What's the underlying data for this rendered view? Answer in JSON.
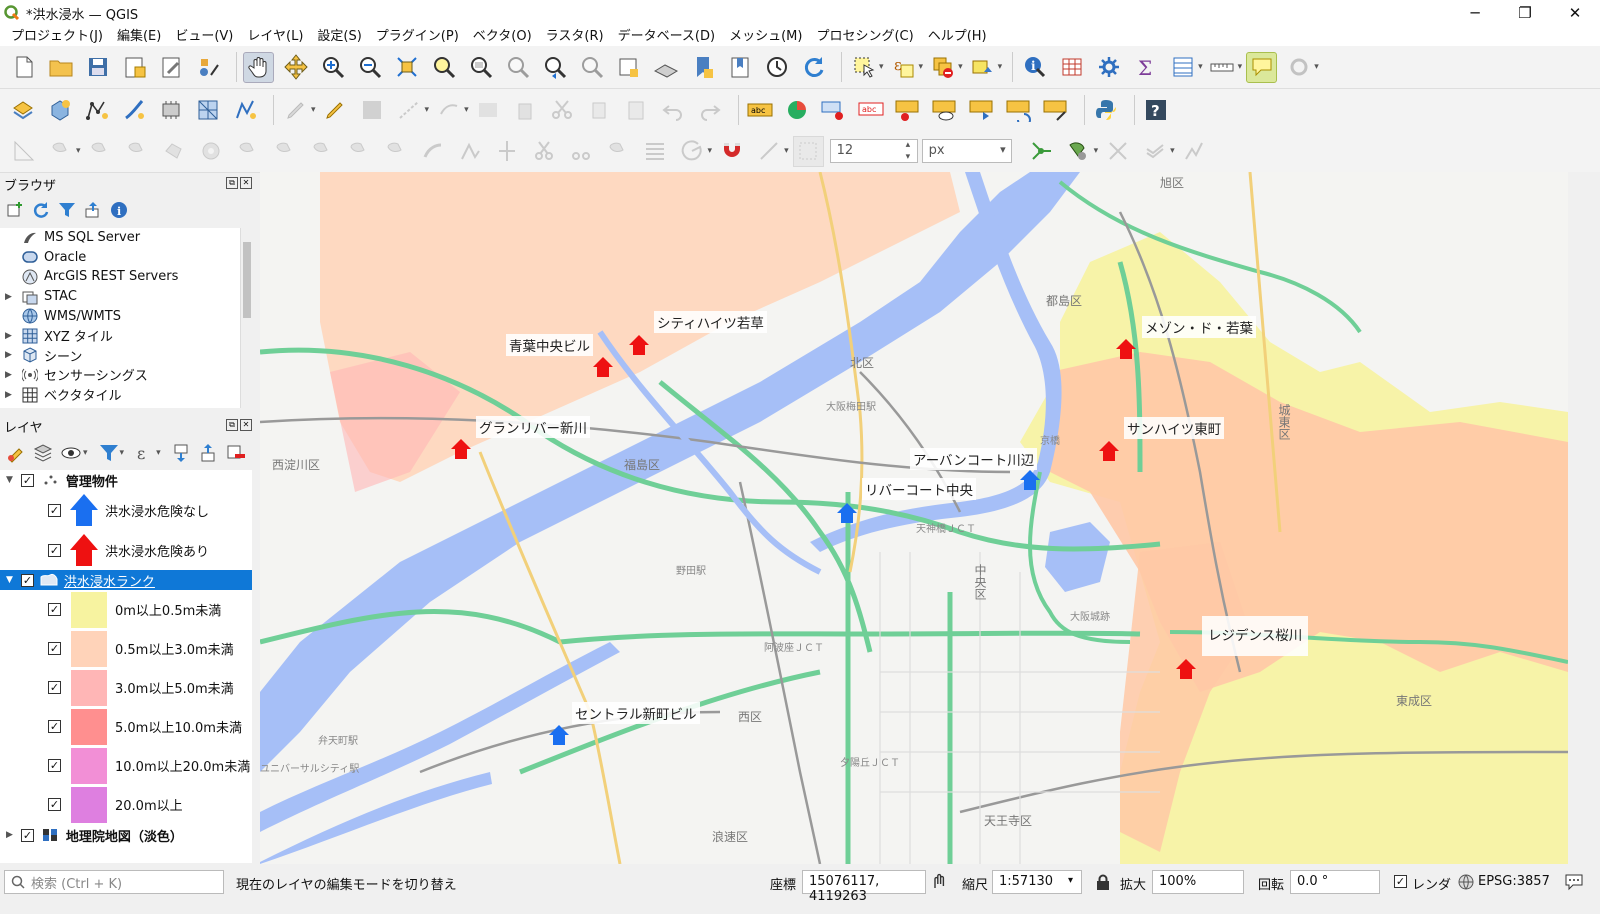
{
  "window": {
    "title": "*洪水浸水 — QGIS",
    "controls": [
      "─",
      "❐",
      "✕"
    ]
  },
  "menu": [
    "プロジェクト(J)",
    "編集(E)",
    "ビュー(V)",
    "レイヤ(L)",
    "設定(S)",
    "プラグイン(P)",
    "ベクタ(O)",
    "ラスタ(R)",
    "データベース(D)",
    "メッシュ(M)",
    "プロセシング(C)",
    "ヘルプ(H)"
  ],
  "digitizing": {
    "tolerance_value": "12",
    "tolerance_unit": "px"
  },
  "browser_panel": {
    "title": "ブラウザ",
    "items": [
      {
        "label": "MS SQL Server",
        "icon": "mssql-icon",
        "expandable": false
      },
      {
        "label": "Oracle",
        "icon": "oracle-icon",
        "expandable": false
      },
      {
        "label": "ArcGIS REST Servers",
        "icon": "arcgis-icon",
        "expandable": false
      },
      {
        "label": "STAC",
        "icon": "stac-icon",
        "expandable": true
      },
      {
        "label": "WMS/WMTS",
        "icon": "globe-icon",
        "expandable": false
      },
      {
        "label": "XYZ タイル",
        "icon": "grid-icon",
        "expandable": true
      },
      {
        "label": "シーン",
        "icon": "cube-icon",
        "expandable": true
      },
      {
        "label": "センサーシングス",
        "icon": "sensor-icon",
        "expandable": true
      },
      {
        "label": "ベクタタイル",
        "icon": "vectortile-icon",
        "expandable": true
      }
    ]
  },
  "layers_panel": {
    "title": "レイヤ",
    "groups": {
      "properties": {
        "label": "管理物件",
        "checked": true
      },
      "safe": {
        "label": "洪水浸水危険なし",
        "checked": true,
        "color": "#1a6ff0"
      },
      "danger": {
        "label": "洪水浸水危険あり",
        "checked": true,
        "color": "#ee1111"
      },
      "flood_rank": {
        "label": "洪水浸水ランク",
        "checked": true
      },
      "basemap": {
        "label": "地理院地図（淡色）",
        "checked": true
      }
    },
    "legend": [
      {
        "label": "0m以上0.5m未満",
        "color": "#f7f3a0"
      },
      {
        "label": "0.5m以上3.0m未満",
        "color": "#ffd3b9"
      },
      {
        "label": "3.0m以上5.0m未満",
        "color": "#ffb6b6"
      },
      {
        "label": "5.0m以上10.0m未満",
        "color": "#ff8f8f"
      },
      {
        "label": "10.0m以上20.0m未満",
        "color": "#f28fd6"
      },
      {
        "label": "20.0m以上",
        "color": "#de7fe0"
      }
    ]
  },
  "map": {
    "buildings": [
      {
        "name": "シティハイツ若草",
        "risk": "danger"
      },
      {
        "name": "青葉中央ビル",
        "risk": "danger"
      },
      {
        "name": "グランリバー新川",
        "risk": "danger"
      },
      {
        "name": "メゾン・ド・若葉",
        "risk": "danger"
      },
      {
        "name": "サンハイツ東町",
        "risk": "danger"
      },
      {
        "name": "アーバンコート川辺",
        "risk": "safe"
      },
      {
        "name": "リバーコート中央",
        "risk": "safe"
      },
      {
        "name": "レジデンス桜川",
        "risk": "danger"
      },
      {
        "name": "セントラル新町ビル",
        "risk": "safe"
      }
    ],
    "place_names": {
      "asahi": "旭区",
      "miyakojima": "都島区",
      "kita": "北区",
      "nishiyodogawa": "西淀川区",
      "fukushima": "福島区",
      "chuo": "中央区",
      "nishi": "西区",
      "naniwa": "浪速区",
      "tennoji": "天王寺区",
      "higashinari": "東成区",
      "joto": "城東区",
      "jct_tenjinbashi": "天神橋ＪＣＴ",
      "jct_awaza": "阿波座ＪＣＴ",
      "jct_ebisu": "夕陽丘ＪＣＴ",
      "osaka_station": "大阪梅田駅",
      "noda": "野田駅",
      "osakajo": "大阪城跡",
      "kyobashi": "京橋",
      "bentencho": "弁天町駅",
      "universal": "ユニバーサルシティ駅"
    }
  },
  "status": {
    "search_placeholder": "検索 (Ctrl + K)",
    "message": "現在のレイヤの編集モードを切り替え",
    "coord_label": "座標",
    "coord_value": "15076117, 4119263",
    "scale_label": "縮尺",
    "scale_value": "1:57130",
    "magnifier_label": "拡大",
    "magnifier_value": "100%",
    "rotation_label": "回転",
    "rotation_value": "0.0 °",
    "render_label": "レンダ",
    "crs": "EPSG:3857"
  }
}
